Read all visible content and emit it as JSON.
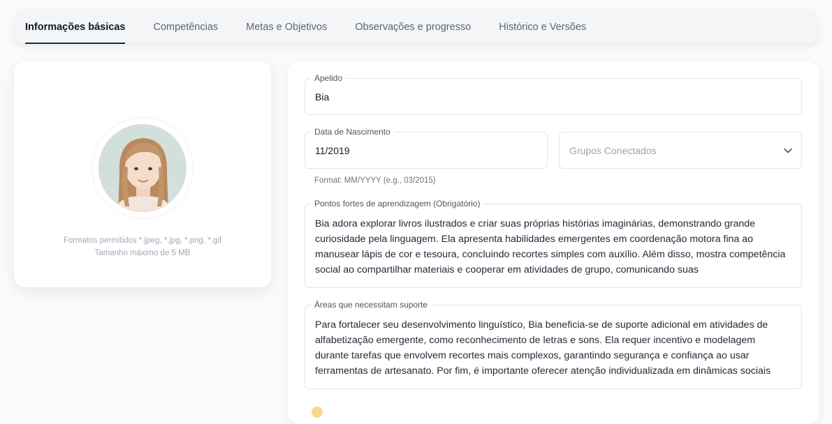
{
  "tabs": [
    {
      "label": "Informações básicas",
      "active": true
    },
    {
      "label": "Competências",
      "active": false
    },
    {
      "label": "Metas e Objetivos",
      "active": false
    },
    {
      "label": "Observações e progresso",
      "active": false
    },
    {
      "label": "Histórico e Versões",
      "active": false
    }
  ],
  "avatar": {
    "allowed_formats": "Formatos permitidos *.jpeg, *.jpg, *.png, *.gif",
    "max_size": "Tamanho máximo de 5 MB"
  },
  "form": {
    "nickname": {
      "label": "Apelido",
      "value": "Bia"
    },
    "birthdate": {
      "label": "Data de Nascimento",
      "value": "11/2019",
      "helper": "Format: MM/YYYY (e.g., 03/2015)"
    },
    "groups": {
      "placeholder": "Grupos Conectados"
    },
    "strengths": {
      "label": "Pontos fortes de aprendizagem (Obrigatório)",
      "value": "Bia adora explorar livros ilustrados e criar suas próprias histórias imaginárias, demonstrando grande curiosidade pela linguagem. Ela apresenta habilidades emergentes em coordenação motora fina ao manusear lápis de cor e tesoura, concluindo recortes simples com auxílio. Além disso, mostra competência social ao compartilhar materiais e cooperar em atividades de grupo, comunicando suas"
    },
    "support": {
      "label": "Áreas que necessitam suporte",
      "value": "Para fortalecer seu desenvolvimento linguístico, Bia beneficia-se de suporte adicional em atividades de alfabetização emergente, como reconhecimento de letras e sons. Ela requer incentivo e modelagem durante tarefas que envolvem recortes mais complexos, garantindo segurança e confiança ao usar ferramentas de artesanato. Por fim, é importante oferecer atenção individualizada em dinâmicas sociais"
    }
  },
  "colors": {
    "active_tab_underline": "#1e2a3e",
    "card_background": "#ffffff",
    "page_background": "#f9fafb"
  }
}
